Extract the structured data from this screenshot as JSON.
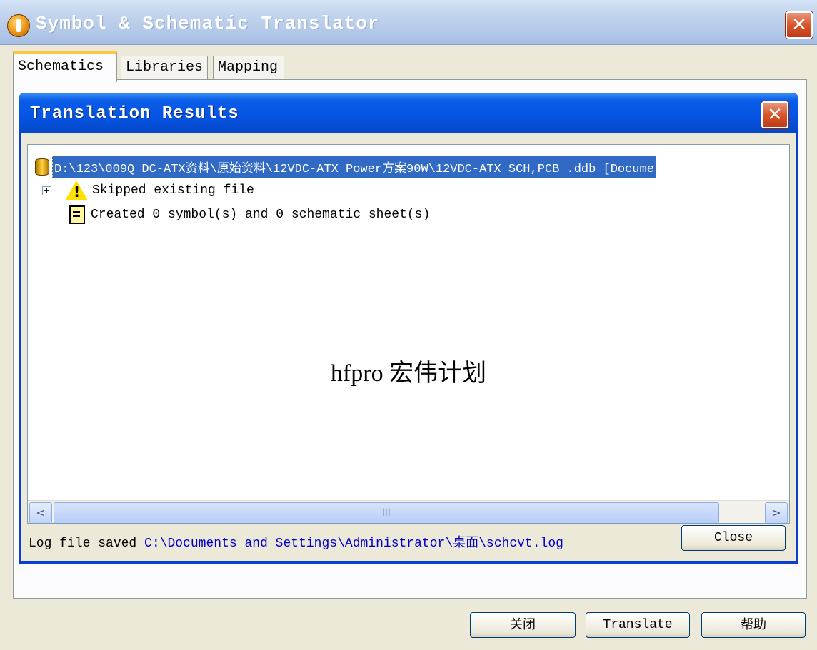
{
  "window": {
    "title": "Symbol & Schematic Translator",
    "close_glyph": "✕"
  },
  "tabs": [
    {
      "label": "Schematics",
      "active": true
    },
    {
      "label": "Libraries",
      "active": false
    },
    {
      "label": "Mapping",
      "active": false
    }
  ],
  "dialog": {
    "title": "Translation Results",
    "close_glyph": "✕",
    "tree": {
      "root": "D:\\123\\009Q DC-ATX资料\\原始资料\\12VDC-ATX Power方案90W\\12VDC-ATX SCH,PCB .ddb [Docume",
      "items": [
        {
          "label": "Skipped existing file",
          "icon": "warning-icon",
          "expandable": true
        },
        {
          "label": "Created 0 symbol(s) and 0 schematic sheet(s)",
          "icon": "document-icon",
          "expandable": false
        }
      ],
      "expand_glyph": "+"
    },
    "watermark": "hfpro 宏伟计划",
    "scrollbar": {
      "left_glyph": "<",
      "right_glyph": ">",
      "thumb_glyph": "III"
    },
    "log": {
      "label": "Log file saved",
      "path": "C:\\Documents and Settings\\Administrator\\桌面\\schcvt.log"
    },
    "close_button": "Close"
  },
  "footer_buttons": {
    "close": "关闭",
    "translate": "Translate",
    "help": "帮助"
  },
  "colors": {
    "selection": "#316ac5",
    "dialog_frame": "#0a3fd0",
    "log_path": "#0000cc"
  }
}
